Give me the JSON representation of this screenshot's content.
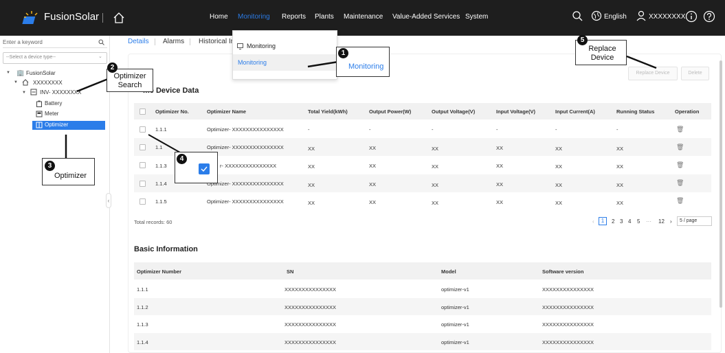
{
  "topbar": {
    "brand": "FusionSolar",
    "nav": [
      "Home",
      "Monitoring",
      "Reports",
      "Plants",
      "Maintenance",
      "Value-Added Services",
      "System"
    ],
    "language": "English",
    "user": "XXXXXXXX"
  },
  "sidebar": {
    "search_placeholder": "Enter a keyword",
    "device_type_placeholder": "--Select a device type--",
    "tree": {
      "root": "FusionSolar",
      "site": "XXXXXXXX",
      "inverter": "INV- XXXXXXXX",
      "battery": "Battery",
      "meter": "Meter",
      "optimizer": "Optimizer"
    }
  },
  "tabs": [
    "Details",
    "Alarms",
    "Historical In"
  ],
  "dropdown": {
    "header": "Monitoring",
    "item": "Monitoring"
  },
  "buttons": {
    "replace": "Replace Device",
    "delete": "Delete"
  },
  "realtime": {
    "title": "me Device Data",
    "columns": [
      "Optimizer No.",
      "Optimizer Name",
      "Total Yield(kWh)",
      "Output Power(W)",
      "Output Voltage(V)",
      "Input Voltage(V)",
      "Input Current(A)",
      "Running Status",
      "Operation"
    ],
    "rows": [
      {
        "no": "1.1.1",
        "name": "Optimizer- XXXXXXXXXXXXXXX",
        "yield": "-",
        "power": "-",
        "ovolt": "-",
        "ivolt": "-",
        "icur": "-",
        "status": "-"
      },
      {
        "no": "1.1",
        "name": "Optimizer- XXXXXXXXXXXXXXX",
        "yield": "XX",
        "power": "XX",
        "ovolt": "XX",
        "ivolt": "XX",
        "icur": "XX",
        "status": "XX"
      },
      {
        "no": "1.1.3",
        "name": "r- XXXXXXXXXXXXXXX",
        "yield": "XX",
        "power": "XX",
        "ovolt": "XX",
        "ivolt": "XX",
        "icur": "XX",
        "status": "XX"
      },
      {
        "no": "1.1.4",
        "name": "Optimizer- XXXXXXXXXXXXXXX",
        "yield": "XX",
        "power": "XX",
        "ovolt": "XX",
        "ivolt": "XX",
        "icur": "XX",
        "status": "XX"
      },
      {
        "no": "1.1.5",
        "name": "Optimizer- XXXXXXXXXXXXXXX",
        "yield": "XX",
        "power": "XX",
        "ovolt": "XX",
        "ivolt": "XX",
        "icur": "XX",
        "status": "XX"
      }
    ],
    "total": "Total records: 60",
    "pages": [
      "1",
      "2",
      "3",
      "4",
      "5",
      "···",
      "12"
    ],
    "page_size": "5 / page"
  },
  "basic": {
    "title": "Basic Information",
    "columns": [
      "Optimizer Number",
      "SN",
      "Model",
      "Software version"
    ],
    "rows": [
      {
        "no": "1.1.1",
        "sn": "XXXXXXXXXXXXXXX",
        "model": "optimizer-v1",
        "sw": "XXXXXXXXXXXXXXX"
      },
      {
        "no": "1.1.2",
        "sn": "XXXXXXXXXXXXXXX",
        "model": "optimizer-v1",
        "sw": "XXXXXXXXXXXXXXX"
      },
      {
        "no": "1.1.3",
        "sn": "XXXXXXXXXXXXXXX",
        "model": "optimizer-v1",
        "sw": "XXXXXXXXXXXXXXX"
      },
      {
        "no": "1.1.4",
        "sn": "XXXXXXXXXXXXXXX",
        "model": "optimizer-v1",
        "sw": "XXXXXXXXXXXXXXX"
      }
    ]
  },
  "callouts": {
    "c1": {
      "num": "1",
      "text": "Monitoring"
    },
    "c2": {
      "num": "2",
      "line1": "Optimizer",
      "line2": "Search"
    },
    "c3": {
      "num": "3",
      "text": "Optimizer"
    },
    "c4": {
      "num": "4"
    },
    "c5": {
      "num": "5",
      "line1": "Replace",
      "line2": "Device"
    }
  },
  "colors": {
    "topbar": "#1e1e1e",
    "accent": "#2b7de9",
    "header_bg": "#f1f1f1"
  }
}
